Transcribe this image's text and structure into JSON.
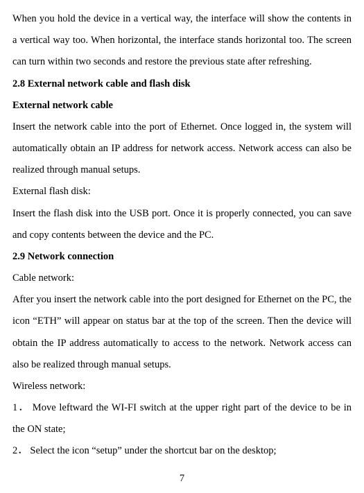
{
  "paragraphs": {
    "p1": "When you hold the device in a vertical way, the interface will show the contents in a vertical way too. When horizontal, the interface stands horizontal too. The screen can turn within two seconds and restore the previous state after refreshing.",
    "h28": "2.8 External network cable and flash disk",
    "sh_cable": "External network cable",
    "p2": "Insert the network cable into the port of Ethernet. Once logged in, the system will automatically obtain an IP address for network access. Network access can also be realized through manual setups.",
    "p3": "External flash disk:",
    "p4": "Insert the flash disk into the USB port. Once it is properly connected, you can save and copy contents between the device and the PC.",
    "h29": "2.9 Network connection",
    "p5": "Cable network:",
    "p6": "After you insert the network cable into the port designed for Ethernet on the PC, the icon “ETH” will appear on status bar at the top of the screen. Then the device will obtain the IP address automatically to access to the network. Network access can also be realized through manual setups.",
    "p7": "Wireless network:",
    "p8": "1． Move leftward the WI-FI switch at the upper right part of the device to be in the ON state;",
    "p9": "2． Select the icon “setup” under the shortcut bar on the desktop;"
  },
  "page_number": "7"
}
